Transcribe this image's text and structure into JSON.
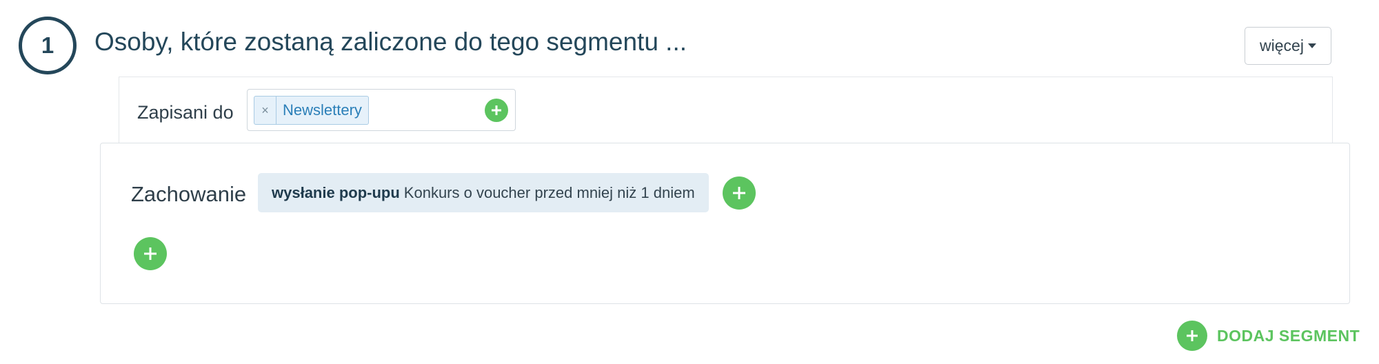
{
  "step": {
    "number": "1",
    "title": "Osoby, które zostaną zaliczone do tego segmentu ..."
  },
  "toolbar": {
    "more_label": "więcej"
  },
  "subscribed": {
    "label": "Zapisani do",
    "tags": [
      {
        "remove_glyph": "×",
        "label": "Newslettery"
      }
    ]
  },
  "behavior": {
    "label": "Zachowanie",
    "condition": {
      "action": "wysłanie pop-upu",
      "detail": "Konkurs o voucher przed mniej niż 1 dniem"
    }
  },
  "footer": {
    "add_segment_label": "DODAJ SEGMENT"
  },
  "colors": {
    "accent_green": "#5cc45f",
    "heading": "#24475a",
    "tag_blue": "#2b7fb8",
    "chip_bg": "#e3edf4"
  },
  "icons": {
    "plus": "plus-icon",
    "remove": "close-icon",
    "dropdown": "caret-down-icon"
  }
}
